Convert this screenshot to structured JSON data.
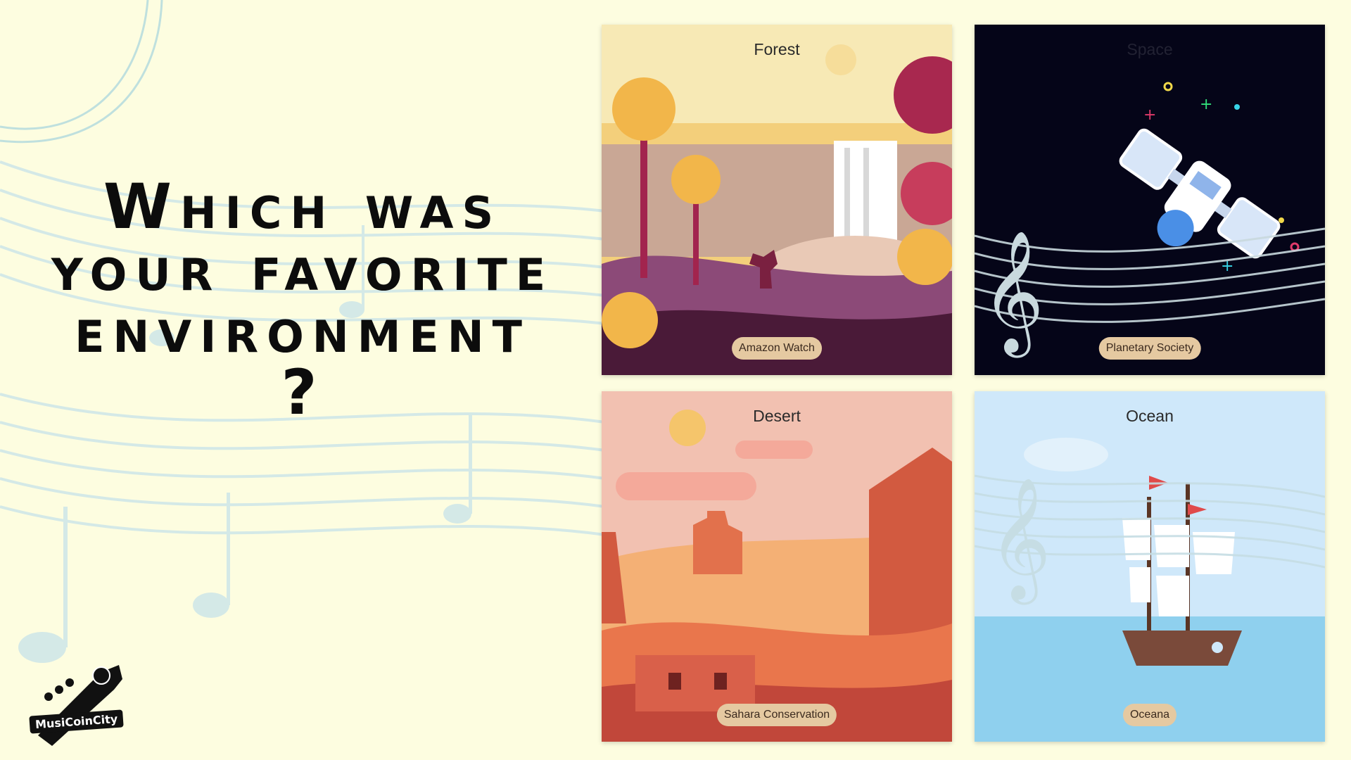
{
  "slide": {
    "question": {
      "line1": "Which was",
      "line2": "your favorite",
      "line3": "environment",
      "mark": "?"
    }
  },
  "cards": {
    "forest": {
      "title": "Forest",
      "button": "Amazon Watch"
    },
    "space": {
      "title": "Space",
      "button": "Planetary Society"
    },
    "desert": {
      "title": "Desert",
      "button": "Sahara Conservation"
    },
    "ocean": {
      "title": "Ocean",
      "button": "Oceana"
    }
  },
  "brand": {
    "name": "MusiCoinCity"
  },
  "colors": {
    "background": "#fdfde0",
    "staff": "#cfe6e4",
    "forest_bg": "#f3d58c",
    "space_bg": "#050518",
    "desert_bg": "#f2c1b1",
    "ocean_bg": "#cfe8fa",
    "button": "#e5c9a1"
  }
}
